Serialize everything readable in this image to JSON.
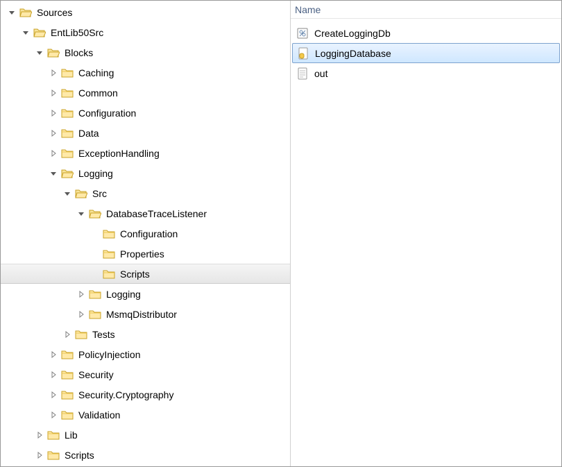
{
  "tree": [
    {
      "label": "Sources",
      "indent": 8,
      "open": true,
      "expander": "open"
    },
    {
      "label": "EntLib50Src",
      "indent": 28,
      "open": true,
      "expander": "open"
    },
    {
      "label": "Blocks",
      "indent": 48,
      "open": true,
      "expander": "open"
    },
    {
      "label": "Caching",
      "indent": 68,
      "open": false,
      "expander": "closed"
    },
    {
      "label": "Common",
      "indent": 68,
      "open": false,
      "expander": "closed"
    },
    {
      "label": "Configuration",
      "indent": 68,
      "open": false,
      "expander": "closed"
    },
    {
      "label": "Data",
      "indent": 68,
      "open": false,
      "expander": "closed"
    },
    {
      "label": "ExceptionHandling",
      "indent": 68,
      "open": false,
      "expander": "closed"
    },
    {
      "label": "Logging",
      "indent": 68,
      "open": true,
      "expander": "open"
    },
    {
      "label": "Src",
      "indent": 88,
      "open": true,
      "expander": "open"
    },
    {
      "label": "DatabaseTraceListener",
      "indent": 108,
      "open": true,
      "expander": "open"
    },
    {
      "label": "Configuration",
      "indent": 128,
      "open": false,
      "expander": "none"
    },
    {
      "label": "Properties",
      "indent": 128,
      "open": false,
      "expander": "none"
    },
    {
      "label": "Scripts",
      "indent": 128,
      "open": false,
      "expander": "none",
      "selected": true
    },
    {
      "label": "Logging",
      "indent": 108,
      "open": false,
      "expander": "closed"
    },
    {
      "label": "MsmqDistributor",
      "indent": 108,
      "open": false,
      "expander": "closed"
    },
    {
      "label": "Tests",
      "indent": 88,
      "open": false,
      "expander": "closed"
    },
    {
      "label": "PolicyInjection",
      "indent": 68,
      "open": false,
      "expander": "closed"
    },
    {
      "label": "Security",
      "indent": 68,
      "open": false,
      "expander": "closed"
    },
    {
      "label": "Security.Cryptography",
      "indent": 68,
      "open": false,
      "expander": "closed"
    },
    {
      "label": "Validation",
      "indent": 68,
      "open": false,
      "expander": "closed"
    },
    {
      "label": "Lib",
      "indent": 48,
      "open": false,
      "expander": "closed"
    },
    {
      "label": "Scripts",
      "indent": 48,
      "open": false,
      "expander": "closed"
    }
  ],
  "listHeader": "Name",
  "files": [
    {
      "label": "CreateLoggingDb",
      "icon": "bat",
      "selected": false
    },
    {
      "label": "LoggingDatabase",
      "icon": "sql",
      "selected": true
    },
    {
      "label": "out",
      "icon": "txt",
      "selected": false
    }
  ]
}
